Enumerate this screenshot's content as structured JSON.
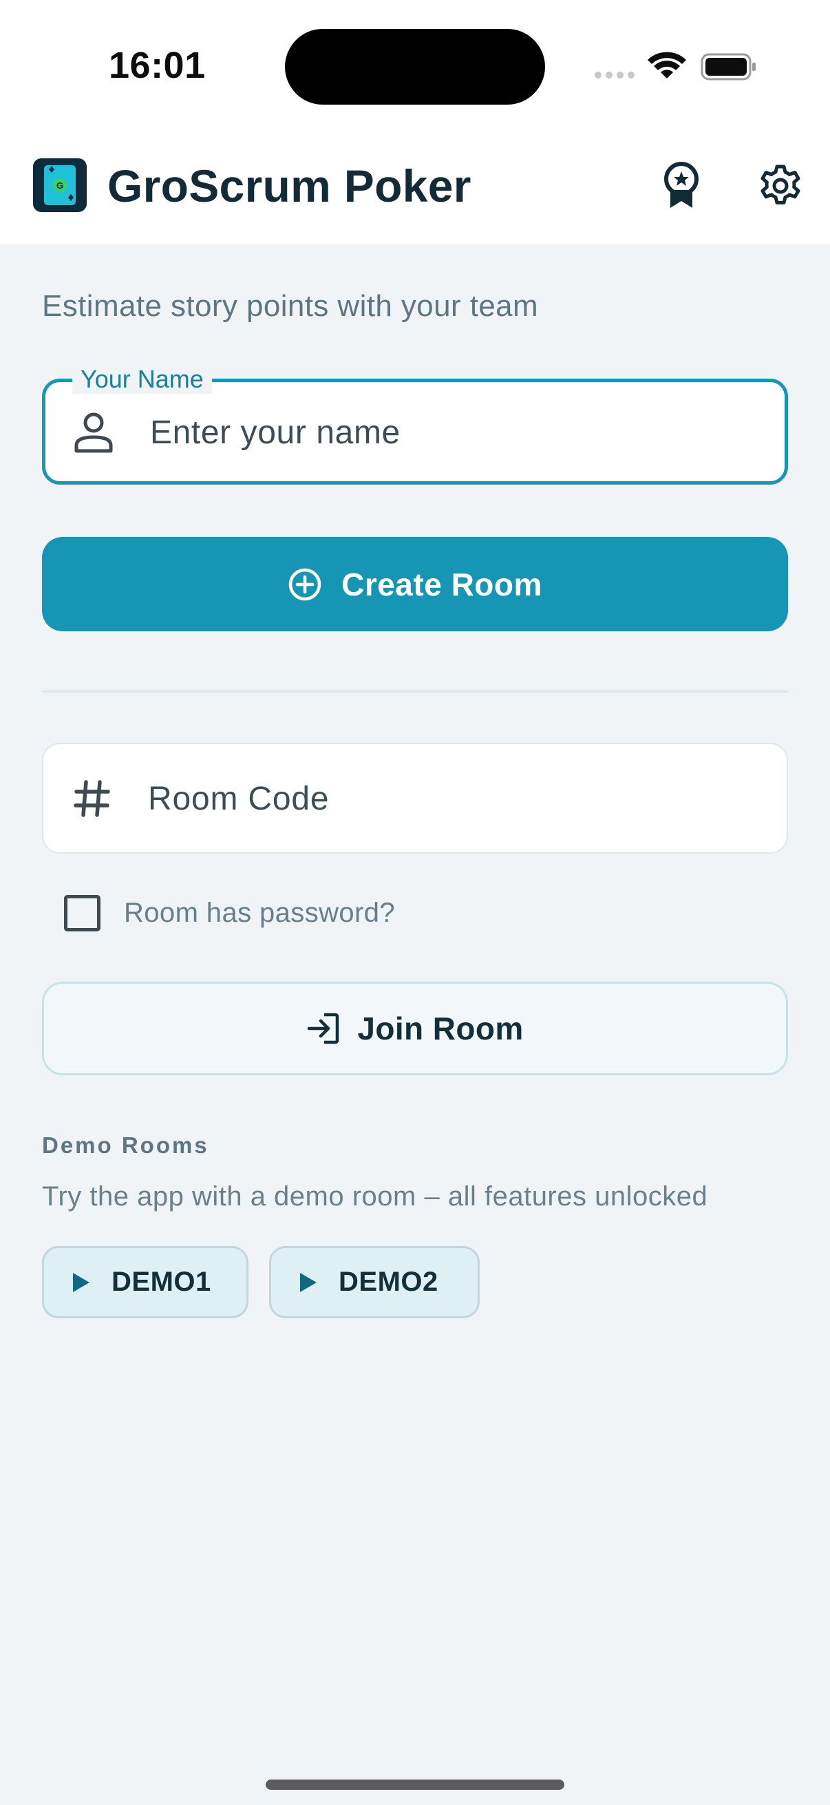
{
  "status_bar": {
    "time": "16:01"
  },
  "app_bar": {
    "title": "GroScrum Poker",
    "logo_letter": "G",
    "actions": [
      "award-icon",
      "settings-icon"
    ]
  },
  "main": {
    "subtitle": "Estimate story points with your team",
    "name_field": {
      "label": "Your Name",
      "placeholder": "Enter your name",
      "icon": "person-icon"
    },
    "create_button": {
      "label": "Create Room",
      "icon": "add-circle-icon"
    },
    "room_code_field": {
      "placeholder": "Room Code",
      "icon": "hash-icon"
    },
    "password_checkbox": {
      "label": "Room has password?",
      "checked": false
    },
    "join_button": {
      "label": "Join Room",
      "icon": "login-icon"
    },
    "demo": {
      "heading": "Demo Rooms",
      "description": "Try the app with a demo room – all features unlocked",
      "rooms": [
        {
          "label": "DEMO1",
          "icon": "play-icon"
        },
        {
          "label": "DEMO2",
          "icon": "play-icon"
        }
      ]
    }
  },
  "colors": {
    "primary": "#1795b4",
    "background": "#f0f4f7",
    "text_dark": "#122b36",
    "text_muted": "#5d7684"
  }
}
